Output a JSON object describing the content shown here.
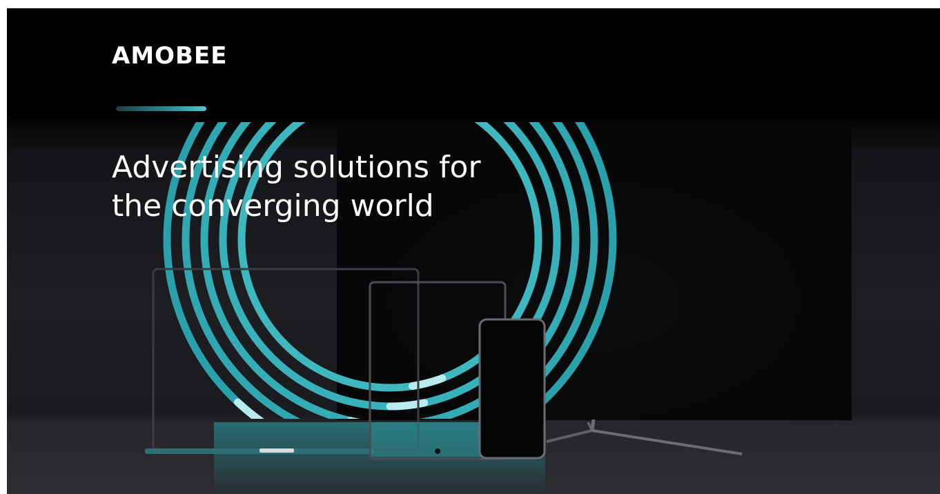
{
  "brand": {
    "logo_text": "AMOBEE",
    "accent_color": "#3fb6c0"
  },
  "hero": {
    "headline_line1": "Advertising solutions for",
    "headline_line2": "the converging world"
  },
  "scene": {
    "devices": [
      "laptop",
      "tablet",
      "smartphone",
      "tv"
    ],
    "ring_color": "#2fa6b0",
    "ring_highlight": "#a9e6ea"
  }
}
